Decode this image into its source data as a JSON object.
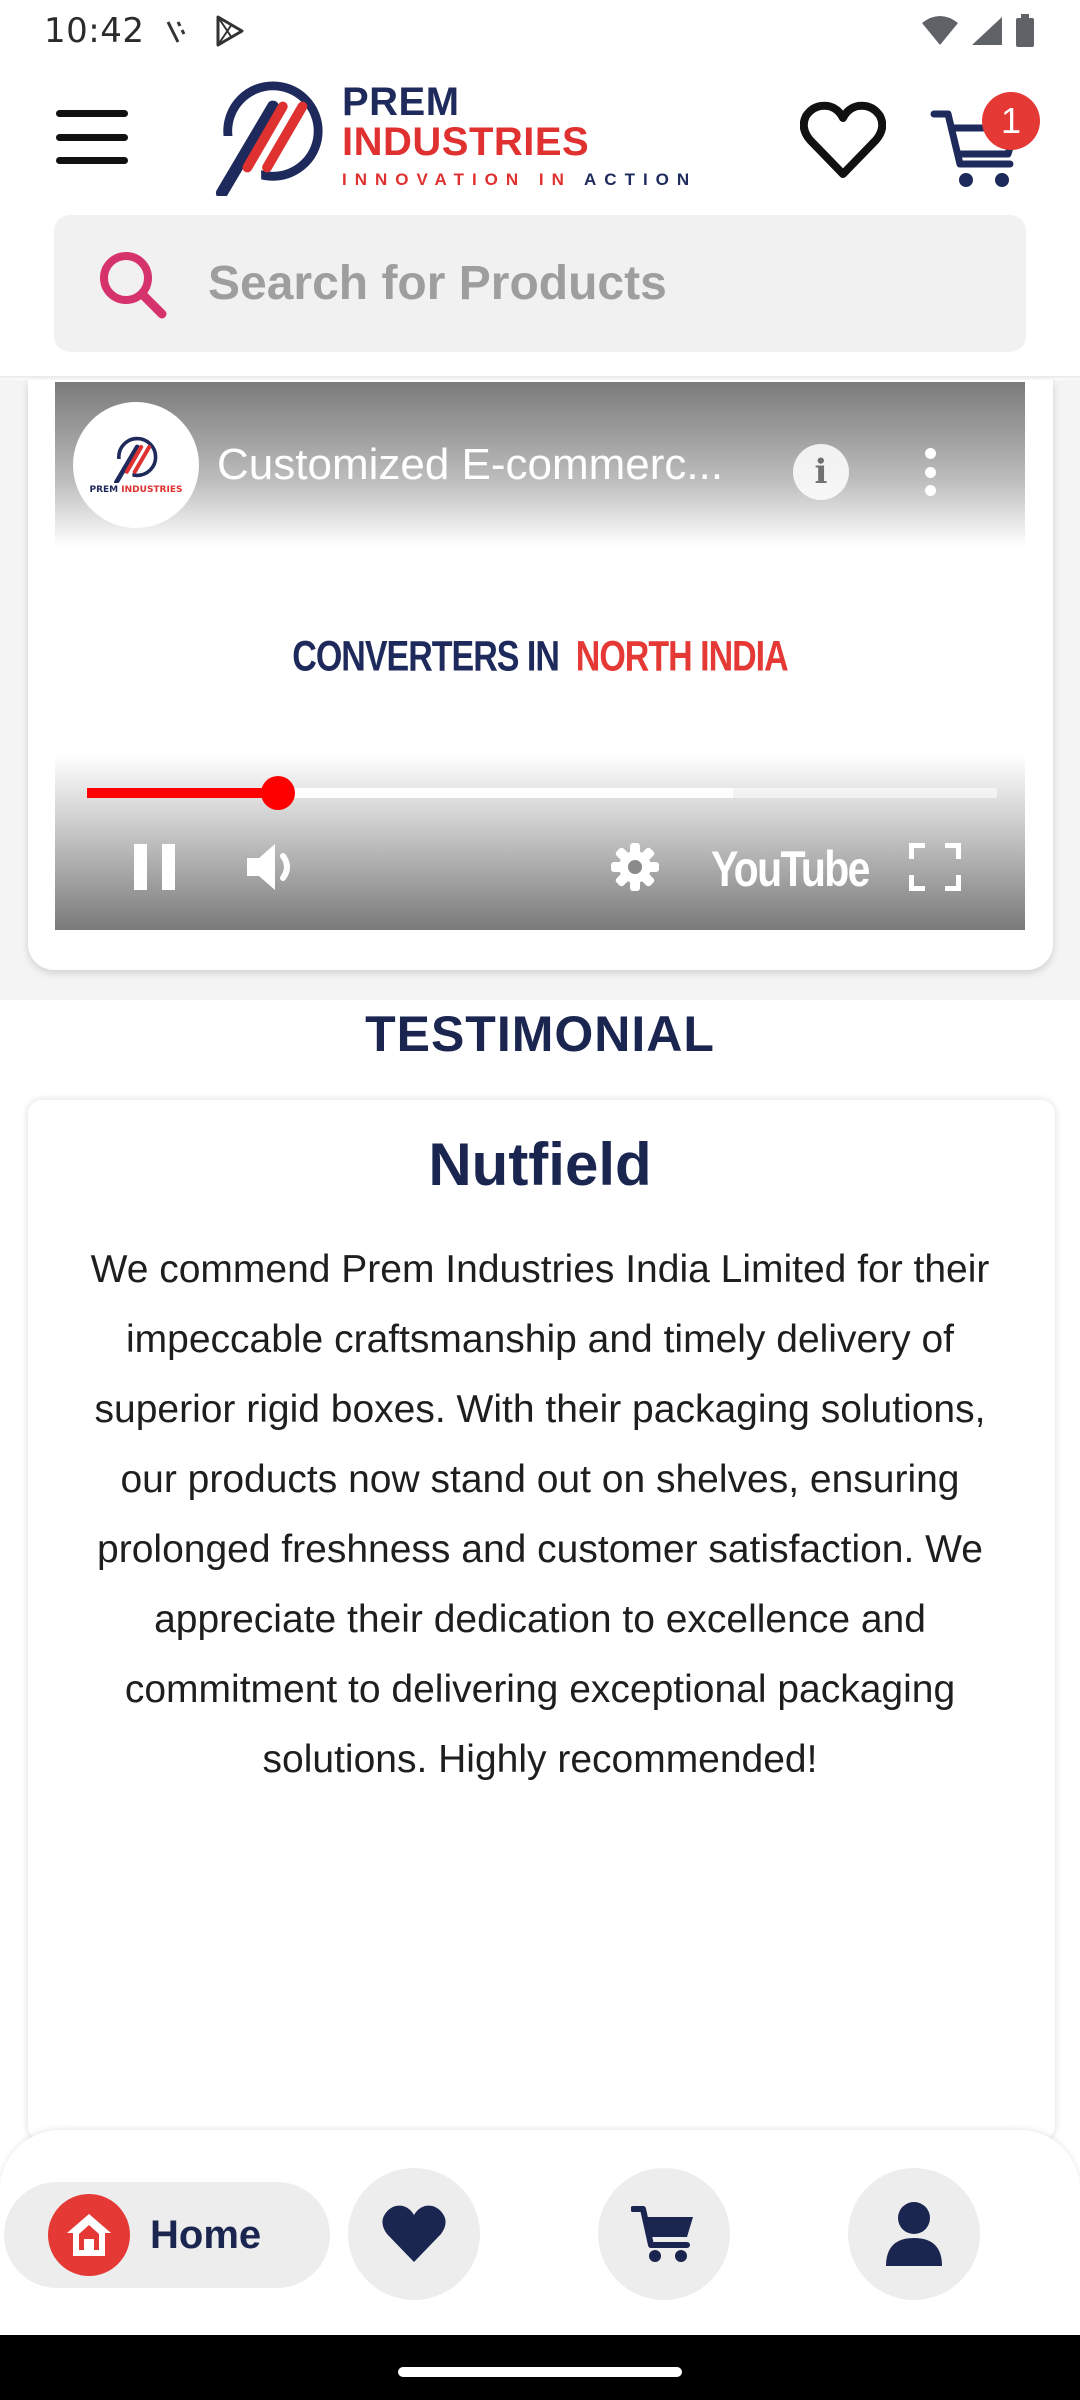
{
  "status_bar": {
    "time": "10:42"
  },
  "header": {
    "brand_left": "PREM",
    "brand_right": "INDUSTRIES",
    "tagline_red": "INNOVATION IN",
    "tagline_navy": "ACTION",
    "cart_count": "1"
  },
  "search": {
    "placeholder": "Search for Products"
  },
  "video": {
    "title": "Customized E-commerc...",
    "frame_text_a": "CONVERTERS IN",
    "frame_text_b": "NORTH INDIA",
    "youtube_label": "YouTube",
    "played_fraction": 0.21,
    "buffered_fraction": 0.71
  },
  "testimonial": {
    "heading": "TESTIMONIAL",
    "name": "Nutfield",
    "text": "We commend Prem Industries India Limited for their impeccable craftsmanship and timely delivery of superior rigid boxes. With their packaging solutions, our products now stand out on shelves, ensuring prolonged freshness and customer satisfaction. We appreciate their dedication to excellence and commitment to delivering exceptional packaging solutions. Highly recommended!"
  },
  "bottom_nav": {
    "home_label": "Home"
  },
  "colors": {
    "navy": "#1a2550",
    "accent_red": "#e53935",
    "youtube_red": "#ff0000"
  }
}
